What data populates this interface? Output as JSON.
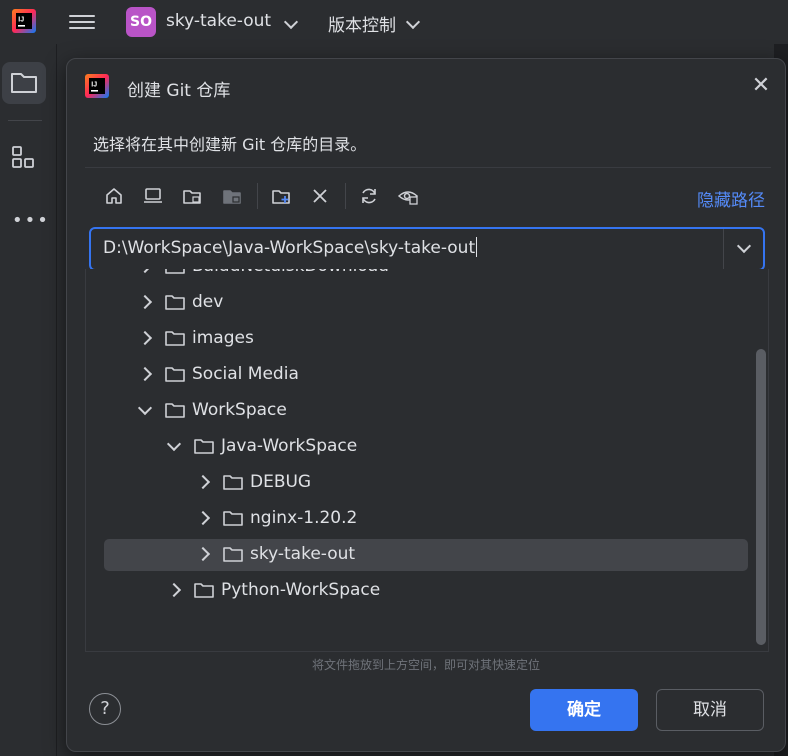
{
  "topbar": {
    "project_badge": "SO",
    "project_name": "sky-take-out",
    "vcs_menu": "版本控制",
    "colors": {
      "badge": "#b954c7"
    }
  },
  "toolstrip": {
    "icons": [
      "project-folder-icon",
      "structure-icon",
      "more-icon"
    ],
    "more_label": "•••"
  },
  "dialog": {
    "title": "创建 Git 仓库",
    "description": "选择将在其中创建新 Git 仓库的目录。",
    "toolbar": {
      "icons": [
        "home-icon",
        "desktop-icon",
        "project-dir-icon",
        "module-dir-icon",
        "new-folder-icon",
        "delete-icon",
        "refresh-icon",
        "show-hidden-icon"
      ],
      "hide_path_label": "隐藏路径"
    },
    "path_value": "D:\\WorkSpace\\Java-WorkSpace\\sky-take-out",
    "tree": [
      {
        "label": "BaiduNetdiskDownload",
        "depth": 0,
        "expanded": false
      },
      {
        "label": "dev",
        "depth": 0,
        "expanded": false
      },
      {
        "label": "images",
        "depth": 0,
        "expanded": false
      },
      {
        "label": "Social Media",
        "depth": 0,
        "expanded": false
      },
      {
        "label": "WorkSpace",
        "depth": 0,
        "expanded": true
      },
      {
        "label": "Java-WorkSpace",
        "depth": 1,
        "expanded": true
      },
      {
        "label": "DEBUG",
        "depth": 2,
        "expanded": false
      },
      {
        "label": "nginx-1.20.2",
        "depth": 2,
        "expanded": false
      },
      {
        "label": "sky-take-out",
        "depth": 2,
        "expanded": false,
        "selected": true
      },
      {
        "label": "Python-WorkSpace",
        "depth": 1,
        "expanded": false
      }
    ],
    "drop_hint": "将文件拖放到上方空间，即可对其快速定位",
    "help_label": "?",
    "ok_label": "确定",
    "cancel_label": "取消",
    "colors": {
      "accent": "#3574f0",
      "link": "#548af7",
      "selection": "#43454a"
    }
  }
}
